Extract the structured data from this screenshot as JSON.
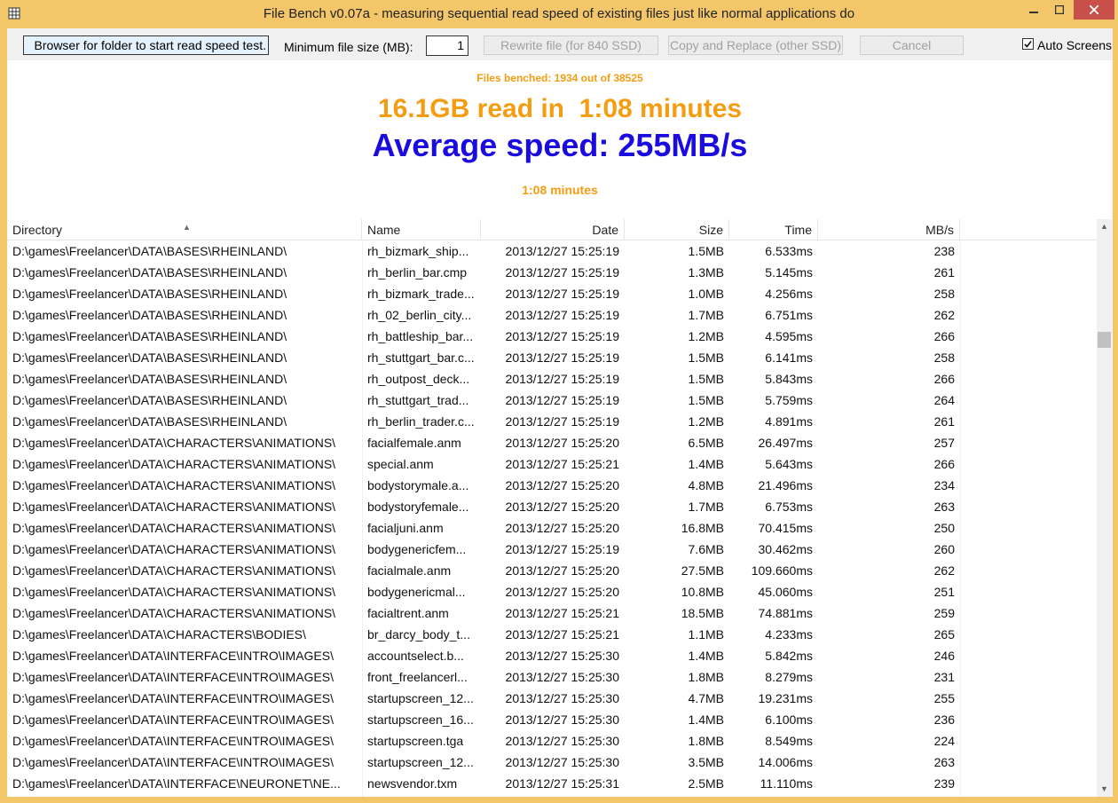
{
  "window": {
    "title": "File Bench v0.07a - measuring sequential read speed of existing files just like normal applications do",
    "icons": {
      "app": "grid-app-icon",
      "minimize": "minimize-icon",
      "maximize": "maximize-icon",
      "close": "close-icon"
    }
  },
  "toolbar": {
    "browse_label": "Browser for folder to start read speed test.",
    "min_size_label": "Minimum file size (MB):",
    "min_size_value": "1",
    "rewrite_label": "Rewrite file (for 840 SSD)",
    "copy_label": "Copy and Replace (other SSD)",
    "cancel_label": "Cancel",
    "auto_label": "Auto Screens",
    "auto_checked": true
  },
  "status": {
    "files_benched": "Files benched: 1934 out of 38525",
    "read_summary": "16.1GB read in  1:08 minutes",
    "average_speed": "Average speed: 255MB/s",
    "elapsed": "1:08 minutes",
    "colors": {
      "orange": "#f59d12",
      "blue": "#1a0be0",
      "frame": "#f3c66a"
    }
  },
  "table": {
    "columns": [
      "Directory",
      "Name",
      "Date",
      "Size",
      "Time",
      "MB/s"
    ],
    "sorted_column": "Directory",
    "rows": [
      [
        "D:\\games\\Freelancer\\DATA\\BASES\\RHEINLAND\\",
        "rh_bizmark_ship...",
        "2013/12/27 15:25:19",
        "1.5MB",
        "6.533ms",
        "238"
      ],
      [
        "D:\\games\\Freelancer\\DATA\\BASES\\RHEINLAND\\",
        "rh_berlin_bar.cmp",
        "2013/12/27 15:25:19",
        "1.3MB",
        "5.145ms",
        "261"
      ],
      [
        "D:\\games\\Freelancer\\DATA\\BASES\\RHEINLAND\\",
        "rh_bizmark_trade...",
        "2013/12/27 15:25:19",
        "1.0MB",
        "4.256ms",
        "258"
      ],
      [
        "D:\\games\\Freelancer\\DATA\\BASES\\RHEINLAND\\",
        "rh_02_berlin_city...",
        "2013/12/27 15:25:19",
        "1.7MB",
        "6.751ms",
        "262"
      ],
      [
        "D:\\games\\Freelancer\\DATA\\BASES\\RHEINLAND\\",
        "rh_battleship_bar...",
        "2013/12/27 15:25:19",
        "1.2MB",
        "4.595ms",
        "266"
      ],
      [
        "D:\\games\\Freelancer\\DATA\\BASES\\RHEINLAND\\",
        "rh_stuttgart_bar.c...",
        "2013/12/27 15:25:19",
        "1.5MB",
        "6.141ms",
        "258"
      ],
      [
        "D:\\games\\Freelancer\\DATA\\BASES\\RHEINLAND\\",
        "rh_outpost_deck...",
        "2013/12/27 15:25:19",
        "1.5MB",
        "5.843ms",
        "266"
      ],
      [
        "D:\\games\\Freelancer\\DATA\\BASES\\RHEINLAND\\",
        "rh_stuttgart_trad...",
        "2013/12/27 15:25:19",
        "1.5MB",
        "5.759ms",
        "264"
      ],
      [
        "D:\\games\\Freelancer\\DATA\\BASES\\RHEINLAND\\",
        "rh_berlin_trader.c...",
        "2013/12/27 15:25:19",
        "1.2MB",
        "4.891ms",
        "261"
      ],
      [
        "D:\\games\\Freelancer\\DATA\\CHARACTERS\\ANIMATIONS\\",
        "facialfemale.anm",
        "2013/12/27 15:25:20",
        "6.5MB",
        "26.497ms",
        "257"
      ],
      [
        "D:\\games\\Freelancer\\DATA\\CHARACTERS\\ANIMATIONS\\",
        "special.anm",
        "2013/12/27 15:25:21",
        "1.4MB",
        "5.643ms",
        "266"
      ],
      [
        "D:\\games\\Freelancer\\DATA\\CHARACTERS\\ANIMATIONS\\",
        "bodystorymale.a...",
        "2013/12/27 15:25:20",
        "4.8MB",
        "21.496ms",
        "234"
      ],
      [
        "D:\\games\\Freelancer\\DATA\\CHARACTERS\\ANIMATIONS\\",
        "bodystoryfemale...",
        "2013/12/27 15:25:20",
        "1.7MB",
        "6.753ms",
        "263"
      ],
      [
        "D:\\games\\Freelancer\\DATA\\CHARACTERS\\ANIMATIONS\\",
        "facialjuni.anm",
        "2013/12/27 15:25:20",
        "16.8MB",
        "70.415ms",
        "250"
      ],
      [
        "D:\\games\\Freelancer\\DATA\\CHARACTERS\\ANIMATIONS\\",
        "bodygenericfem...",
        "2013/12/27 15:25:19",
        "7.6MB",
        "30.462ms",
        "260"
      ],
      [
        "D:\\games\\Freelancer\\DATA\\CHARACTERS\\ANIMATIONS\\",
        "facialmale.anm",
        "2013/12/27 15:25:20",
        "27.5MB",
        "109.660ms",
        "262"
      ],
      [
        "D:\\games\\Freelancer\\DATA\\CHARACTERS\\ANIMATIONS\\",
        "bodygenericmal...",
        "2013/12/27 15:25:20",
        "10.8MB",
        "45.060ms",
        "251"
      ],
      [
        "D:\\games\\Freelancer\\DATA\\CHARACTERS\\ANIMATIONS\\",
        "facialtrent.anm",
        "2013/12/27 15:25:21",
        "18.5MB",
        "74.881ms",
        "259"
      ],
      [
        "D:\\games\\Freelancer\\DATA\\CHARACTERS\\BODIES\\",
        "br_darcy_body_t...",
        "2013/12/27 15:25:21",
        "1.1MB",
        "4.233ms",
        "265"
      ],
      [
        "D:\\games\\Freelancer\\DATA\\INTERFACE\\INTRO\\IMAGES\\",
        "accountselect.b...",
        "2013/12/27 15:25:30",
        "1.4MB",
        "5.842ms",
        "246"
      ],
      [
        "D:\\games\\Freelancer\\DATA\\INTERFACE\\INTRO\\IMAGES\\",
        "front_freelancerl...",
        "2013/12/27 15:25:30",
        "1.8MB",
        "8.279ms",
        "231"
      ],
      [
        "D:\\games\\Freelancer\\DATA\\INTERFACE\\INTRO\\IMAGES\\",
        "startupscreen_12...",
        "2013/12/27 15:25:30",
        "4.7MB",
        "19.231ms",
        "255"
      ],
      [
        "D:\\games\\Freelancer\\DATA\\INTERFACE\\INTRO\\IMAGES\\",
        "startupscreen_16...",
        "2013/12/27 15:25:30",
        "1.4MB",
        "6.100ms",
        "236"
      ],
      [
        "D:\\games\\Freelancer\\DATA\\INTERFACE\\INTRO\\IMAGES\\",
        "startupscreen.tga",
        "2013/12/27 15:25:30",
        "1.8MB",
        "8.549ms",
        "224"
      ],
      [
        "D:\\games\\Freelancer\\DATA\\INTERFACE\\INTRO\\IMAGES\\",
        "startupscreen_12...",
        "2013/12/27 15:25:30",
        "3.5MB",
        "14.006ms",
        "263"
      ],
      [
        "D:\\games\\Freelancer\\DATA\\INTERFACE\\NEURONET\\NE...",
        "newsvendor.txm",
        "2013/12/27 15:25:31",
        "2.5MB",
        "11.110ms",
        "239"
      ]
    ]
  },
  "scrollbar": {
    "position_fraction": 0.18
  }
}
